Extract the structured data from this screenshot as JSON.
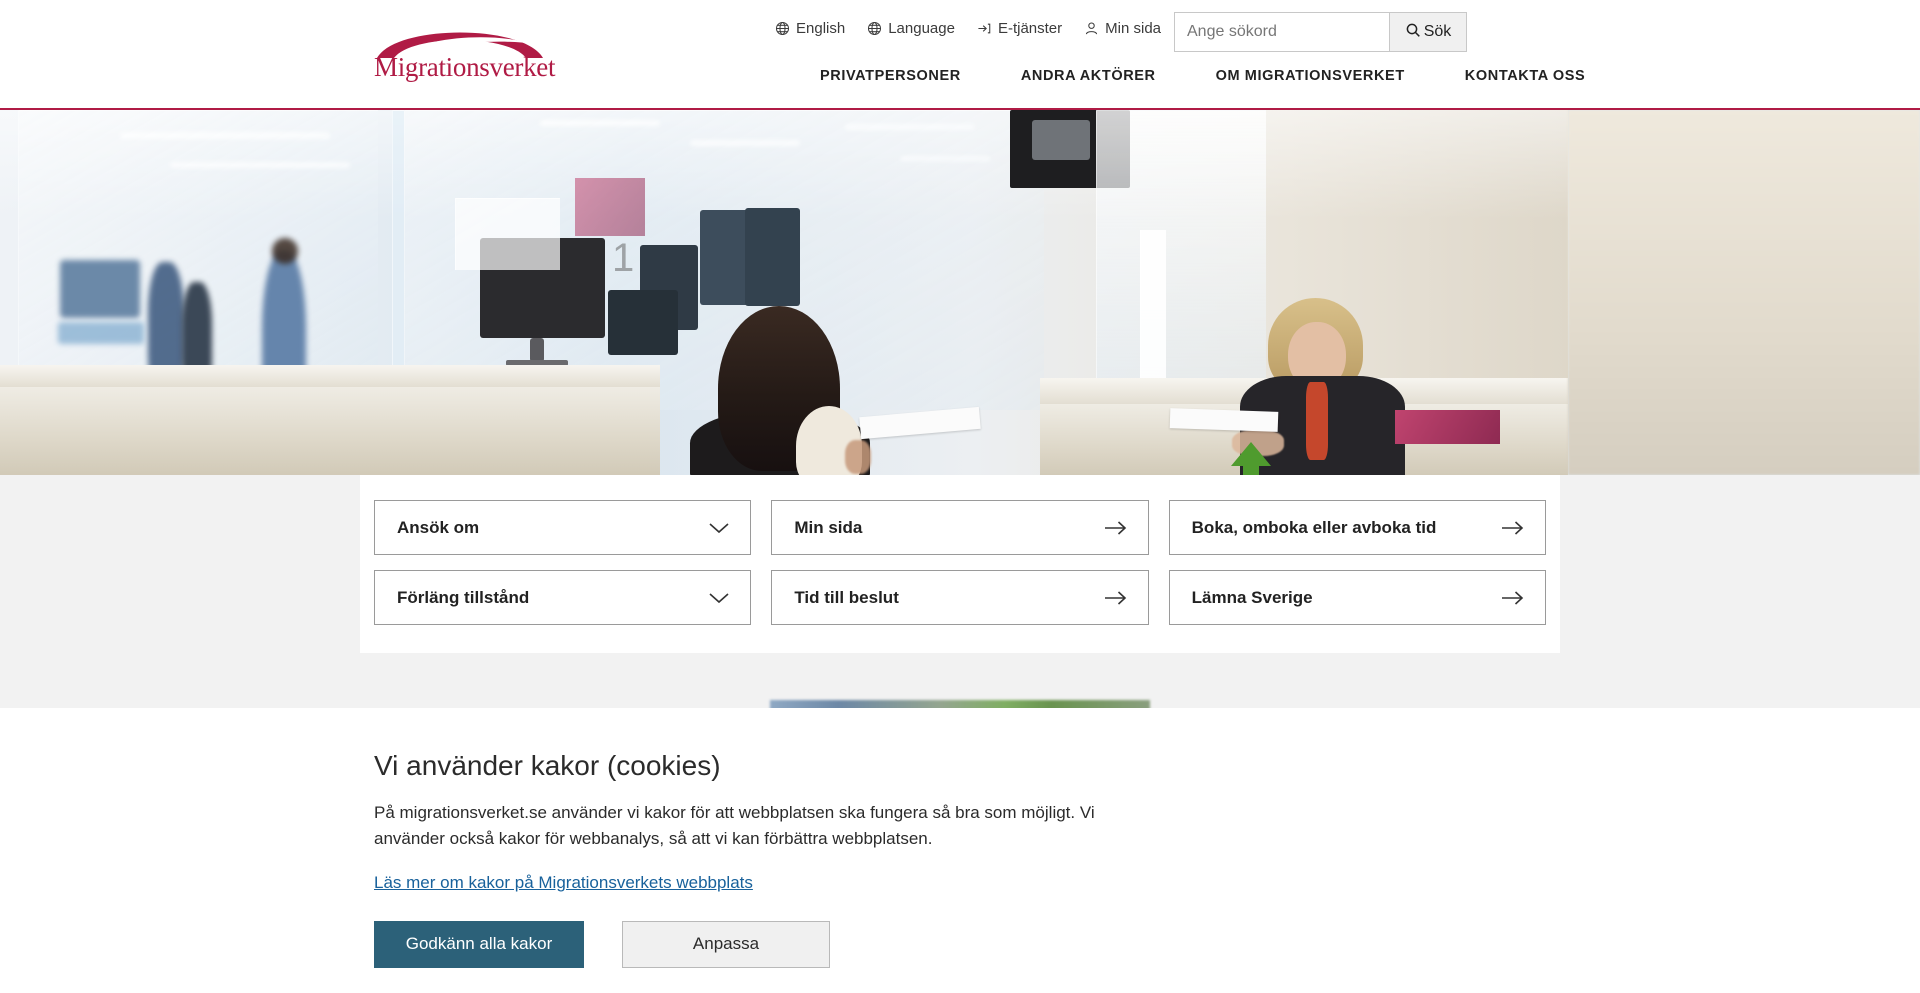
{
  "brand": {
    "name": "Migrationsverket",
    "logo_color": "#b01b45"
  },
  "header": {
    "utility": [
      {
        "label": "English",
        "icon": "globe-icon"
      },
      {
        "label": "Language",
        "icon": "globe-icon"
      },
      {
        "label": "E-tjänster",
        "icon": "login-arrow-icon"
      },
      {
        "label": "Min sida",
        "icon": "person-icon"
      }
    ],
    "search": {
      "placeholder": "Ange sökord",
      "value": "",
      "button_label": "Sök",
      "button_icon": "search-icon"
    },
    "nav": [
      {
        "label": "PRIVATPERSONER"
      },
      {
        "label": "ANDRA AKTÖRER"
      },
      {
        "label": "OM MIGRATIONSVERKET"
      },
      {
        "label": "KONTAKTA OSS"
      }
    ]
  },
  "quick_links": {
    "cards": [
      {
        "label": "Ansök om",
        "icon": "chevron-down-icon"
      },
      {
        "label": "Min sida",
        "icon": "arrow-right-icon"
      },
      {
        "label": "Boka, omboka eller avboka tid",
        "icon": "arrow-right-icon"
      },
      {
        "label": "Förläng tillstånd",
        "icon": "chevron-down-icon"
      },
      {
        "label": "Tid till beslut",
        "icon": "arrow-right-icon"
      },
      {
        "label": "Lämna Sverige",
        "icon": "arrow-right-icon"
      }
    ]
  },
  "cookie_banner": {
    "title": "Vi använder kakor (cookies)",
    "body": "På migrationsverket.se använder vi kakor för att webbplatsen ska fungera så bra som möjligt. Vi använder också kakor för webbanalys, så att vi kan förbättra webbplatsen.",
    "link_label": "Läs mer om kakor på Migrationsverkets webbplats",
    "accept_label": "Godkänn alla kakor",
    "customize_label": "Anpassa",
    "accept_color": "#2c6179",
    "link_color": "#18619b"
  }
}
